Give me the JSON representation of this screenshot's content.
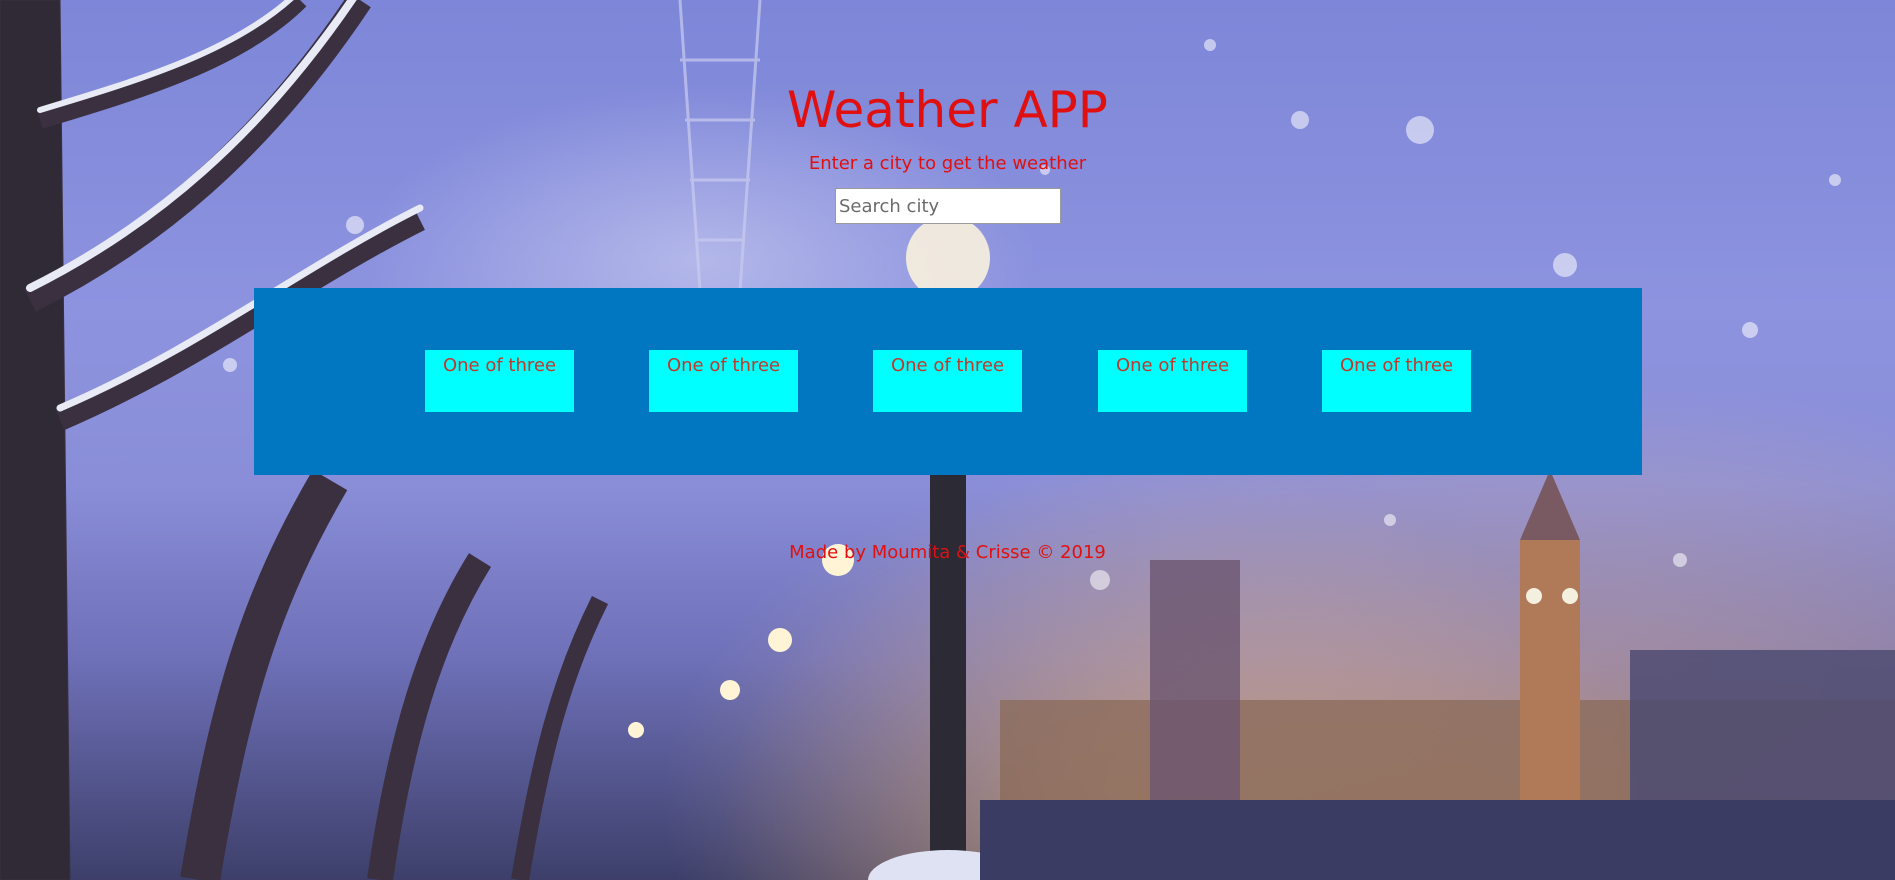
{
  "header": {
    "title": "Weather APP",
    "subtitle": "Enter a city to get the weather"
  },
  "search": {
    "placeholder": "Search city",
    "value": ""
  },
  "forecast": {
    "cards": [
      {
        "label": "One of three"
      },
      {
        "label": "One of three"
      },
      {
        "label": "One of three"
      },
      {
        "label": "One of three"
      },
      {
        "label": "One of three"
      }
    ]
  },
  "footer": {
    "text": "Made by Moumita & Crisse © 2019"
  },
  "colors": {
    "title": "#e01010",
    "panel": "#0077c0",
    "card": "#00ffff",
    "card_text": "#c0392b"
  }
}
